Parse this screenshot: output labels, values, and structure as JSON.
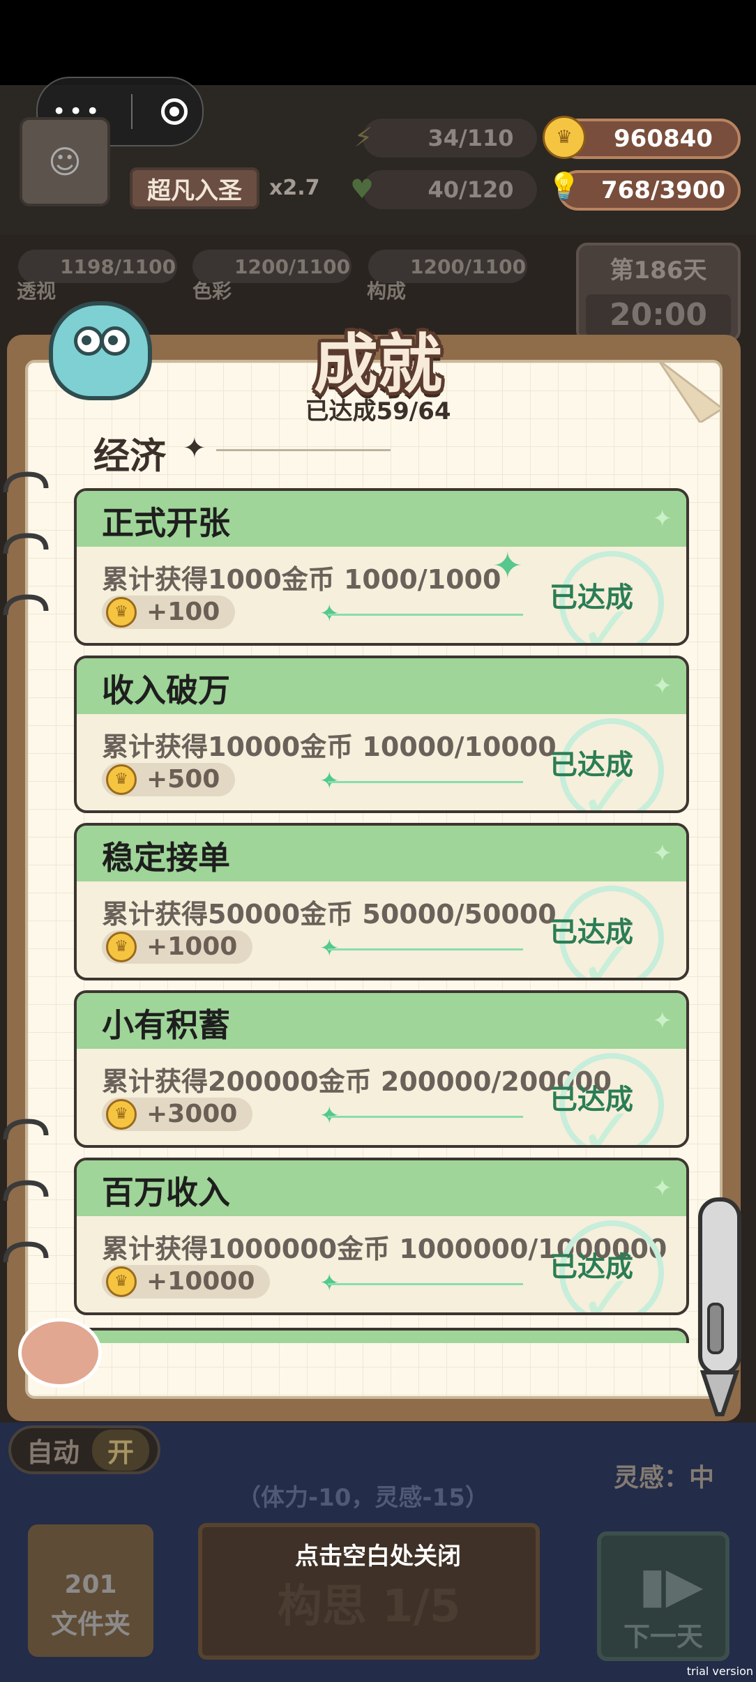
{
  "hud": {
    "rank": "超凡入圣",
    "multiplier": "x2.7",
    "energy": "34/110",
    "health": "40/120",
    "gold": "960840",
    "idea": "768/3900",
    "skills": [
      {
        "value": "1198/1100",
        "label": "透视"
      },
      {
        "value": "1200/1100",
        "label": "色彩"
      },
      {
        "value": "1200/1100",
        "label": "构成"
      }
    ],
    "day": "第186天",
    "time": "20:00"
  },
  "panel": {
    "title": "成就",
    "progress": "已达成59/64",
    "section": "经济",
    "achievements": [
      {
        "name": "正式开张",
        "desc": "累计获得1000金币 1000/1000",
        "reward": "+100",
        "status": "已达成"
      },
      {
        "name": "收入破万",
        "desc": "累计获得10000金币 10000/10000",
        "reward": "+500",
        "status": "已达成"
      },
      {
        "name": "稳定接单",
        "desc": "累计获得50000金币 50000/50000",
        "reward": "+1000",
        "status": "已达成"
      },
      {
        "name": "小有积蓄",
        "desc": "累计获得200000金币 200000/200000",
        "reward": "+3000",
        "status": "已达成"
      },
      {
        "name": "百万收入",
        "desc": "累计获得1000000金币 1000000/1000000",
        "reward": "+10000",
        "status": "已达成"
      }
    ]
  },
  "bottom": {
    "auto_label": "自动",
    "auto_state": "开",
    "inspiration": "灵感：中",
    "cost": "（体力-10，灵感-15）",
    "folder_count": "201",
    "folder_label": "文件夹",
    "main_button": "构思 1/5",
    "close_hint": "点击空白处关闭",
    "next_day": "下一天"
  },
  "watermark": "trial version",
  "colors": {
    "card_header": "#9fd598",
    "card_body": "#f6efdb",
    "achieved_text": "#2b7d55",
    "notebook": "#fdf8ea"
  },
  "icons": [
    "more-icon",
    "target-icon",
    "lightning-icon",
    "heart-icon",
    "coin-icon",
    "bulb-icon",
    "check-icon",
    "sparkle-icon",
    "pen-icon",
    "next-icon"
  ]
}
